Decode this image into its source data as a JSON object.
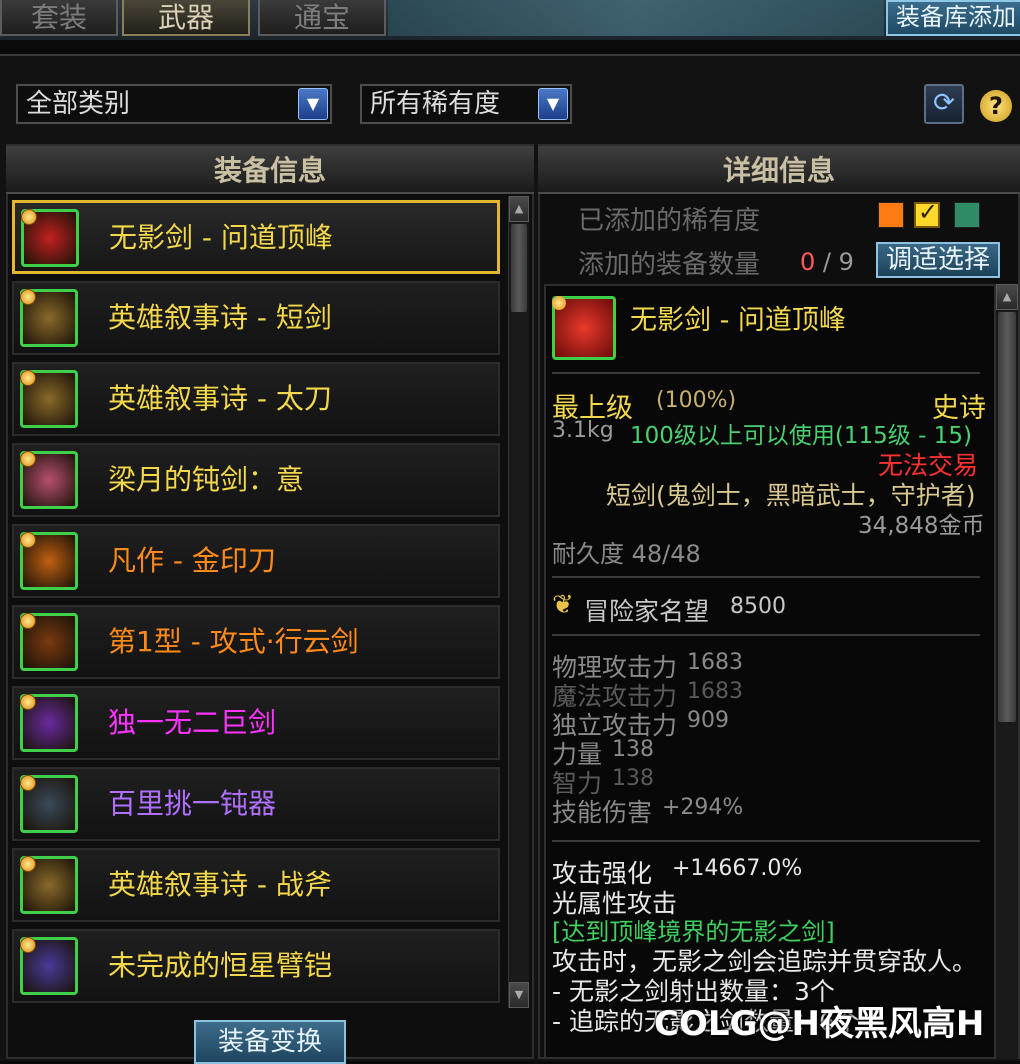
{
  "tabs": [
    {
      "label": "套装",
      "active": false
    },
    {
      "label": "武器",
      "active": true
    },
    {
      "label": "通宝",
      "active": false
    }
  ],
  "repo_add_button": "装备库添加",
  "filters": {
    "category": "全部类别",
    "rarity": "所有稀有度"
  },
  "left_panel": {
    "title": "装备信息",
    "items": [
      {
        "name": "无影剑 - 问道顶峰",
        "color": "#f2d84a",
        "icon": "crimson-dragon-icon",
        "icon_bg": "#c22020"
      },
      {
        "name": "英雄叙事诗 - 短剑",
        "color": "#f2d84a",
        "icon": "golden-shortsword-icon",
        "icon_bg": "#8a6a2a"
      },
      {
        "name": "英雄叙事诗 - 太刀",
        "color": "#f2d84a",
        "icon": "golden-katana-icon",
        "icon_bg": "#8a6a2a"
      },
      {
        "name": "梁月的钝剑：意",
        "color": "#f2d84a",
        "icon": "pink-blunt-sword-icon",
        "icon_bg": "#b85070"
      },
      {
        "name": "凡作 - 金印刀",
        "color": "#ff8a1a",
        "icon": "flame-blade-icon",
        "icon_bg": "#c06010"
      },
      {
        "name": "第1型 - 攻式·行云剑",
        "color": "#ff8a1a",
        "icon": "bronze-sword-icon",
        "icon_bg": "#7a3a10"
      },
      {
        "name": "独一无二巨剑",
        "color": "#ff33ff",
        "icon": "violet-greatsword-icon",
        "icon_bg": "#6a2aa0"
      },
      {
        "name": "百里挑一钝器",
        "color": "#b070ff",
        "icon": "silver-mace-icon",
        "icon_bg": "#3a4a5a"
      },
      {
        "name": "英雄叙事诗 - 战斧",
        "color": "#f2d84a",
        "icon": "golden-battleaxe-icon",
        "icon_bg": "#8a6a2a"
      },
      {
        "name": "未完成的恒星臂铠",
        "color": "#f2d84a",
        "icon": "stellar-gauntlet-icon",
        "icon_bg": "#4a3a9a"
      }
    ],
    "swap_button": "装备变换"
  },
  "right_panel": {
    "title": "详细信息",
    "added_rarity_label": "已添加的稀有度",
    "added_count_label": "添加的装备数量",
    "added_count": "0",
    "added_max": "9",
    "adjust_button": "调适选择",
    "rarity_swatches": [
      "#ff7a12",
      "#ffd92a",
      "#2f8a66"
    ]
  },
  "detail": {
    "name": "无影剑 - 问道顶峰",
    "grade": "最上级",
    "grade_pct": "(100%)",
    "rarity": "史诗",
    "weight": "3.1kg",
    "level_req": "100级以上可以使用(115级 - 15)",
    "trade": "无法交易",
    "type": "短剑(鬼剑士，黑暗武士，守护者)",
    "price": "34,848金币",
    "durability": "耐久度 48/48",
    "fame_label": "冒险家名望",
    "fame_value": "8500",
    "stats": [
      {
        "label": "物理攻击力",
        "value": "1683",
        "color": "#8a8a8a"
      },
      {
        "label": "魔法攻击力",
        "value": "1683",
        "color": "#5a5a5a"
      },
      {
        "label": "独立攻击力",
        "value": "909",
        "color": "#8a8a8a"
      },
      {
        "label": "力量",
        "value": "138",
        "color": "#8a8a8a"
      },
      {
        "label": "智力",
        "value": "138",
        "color": "#5a5a5a"
      },
      {
        "label": "技能伤害",
        "value": "+294%",
        "color": "#8a8a8a"
      }
    ],
    "attack_enhance_label": "攻击强化",
    "attack_enhance_value": "+14667.0%",
    "element": "光属性攻击",
    "set_name": "[达到顶峰境界的无影之剑]",
    "effect_line": "攻击时，无影之剑会追踪并贯穿敌人。",
    "bullet_1": "- 无影之剑射出数量：3个",
    "bullet_2": "- 追踪的无影之剑数量：6个"
  },
  "watermark": "@H夜黑风高H",
  "watermark_logo": "COLG"
}
